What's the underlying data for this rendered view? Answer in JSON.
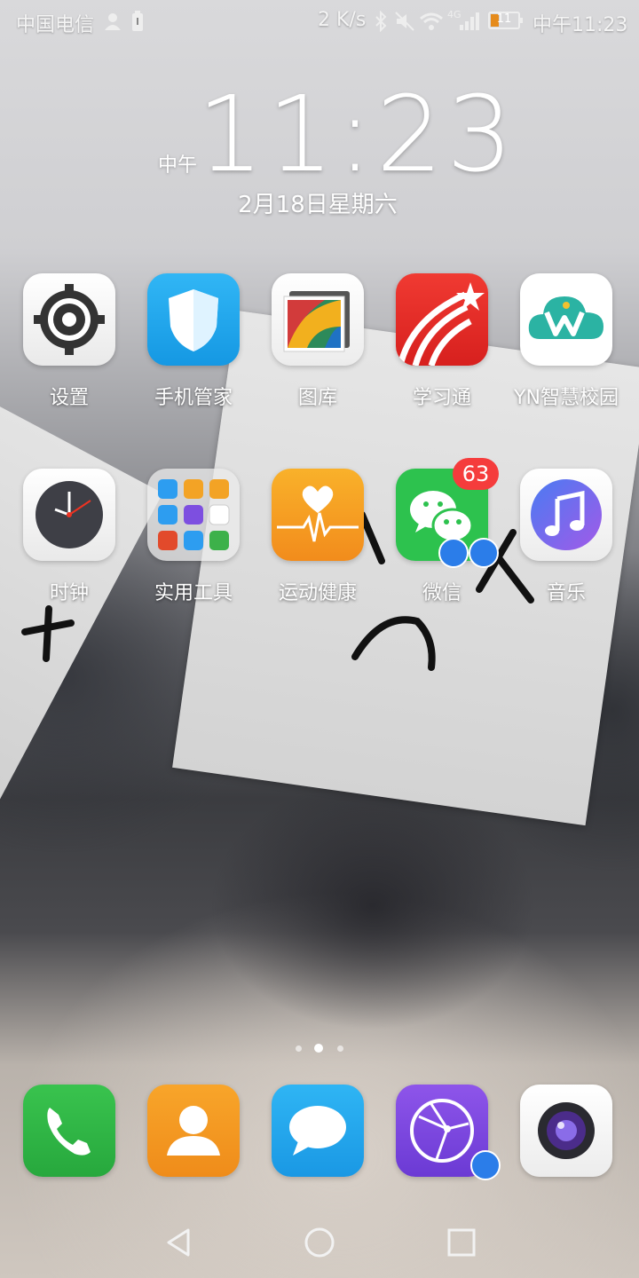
{
  "status_bar": {
    "carrier": "中国电信",
    "net_speed": "2 K/s",
    "network_type": "4G",
    "battery_level": "11",
    "time": "中午11:23"
  },
  "clock_widget": {
    "ampm": "中午",
    "time": "11:23",
    "date": "2月18日星期六"
  },
  "apps_row1": [
    {
      "label": "设置",
      "icon": "settings-icon"
    },
    {
      "label": "手机管家",
      "icon": "shield-icon"
    },
    {
      "label": "图库",
      "icon": "gallery-icon"
    },
    {
      "label": "学习通",
      "icon": "xuexitong-icon"
    },
    {
      "label": "YN智慧校园",
      "icon": "cloud-w-icon"
    }
  ],
  "apps_row2": [
    {
      "label": "时钟",
      "icon": "clock-icon"
    },
    {
      "label": "实用工具",
      "icon": "folder-icon"
    },
    {
      "label": "运动健康",
      "icon": "heart-icon"
    },
    {
      "label": "微信",
      "icon": "wechat-icon",
      "badge": "63"
    },
    {
      "label": "音乐",
      "icon": "music-icon"
    }
  ],
  "dock": [
    {
      "name": "phone",
      "icon": "phone-icon"
    },
    {
      "name": "contacts",
      "icon": "contacts-icon"
    },
    {
      "name": "messages",
      "icon": "message-icon"
    },
    {
      "name": "browser",
      "icon": "globe-icon"
    },
    {
      "name": "camera",
      "icon": "camera-icon"
    }
  ],
  "page_indicator": {
    "pages": 3,
    "current": 2
  }
}
